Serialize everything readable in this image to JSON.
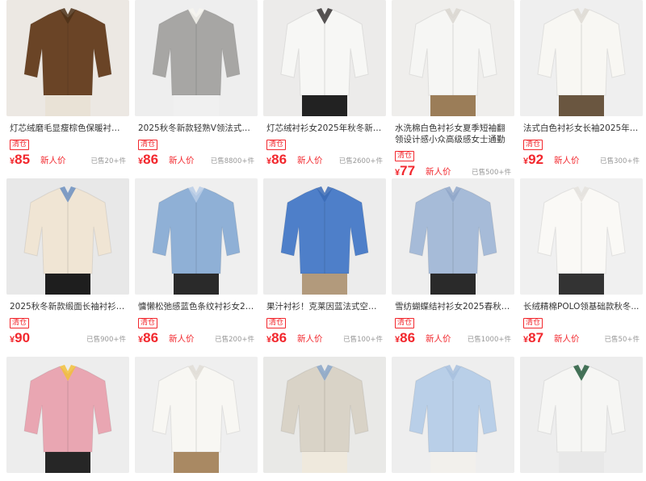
{
  "colors": {
    "accent": "#f2272d",
    "muted": "#999999",
    "text": "#333333"
  },
  "products": [
    {
      "title": "灯芯绒磨毛显瘦棕色保暖衬衫女...",
      "tag": "清仓",
      "currency": "¥",
      "price": "85",
      "label": "新人价",
      "sold": "已售20+件"
    },
    {
      "title": "2025秋冬新款轻熟V领法式长袖...",
      "tag": "清仓",
      "currency": "¥",
      "price": "86",
      "label": "新人价",
      "sold": "已售8800+件"
    },
    {
      "title": "灯芯绒衬衫女2025年秋冬新款...",
      "tag": "清仓",
      "currency": "¥",
      "price": "86",
      "label": "新人价",
      "sold": "已售2600+件"
    },
    {
      "title": "水洗棉白色衬衫女夏季短袖翻领设计感小众高级感女士通勤面试衬衣",
      "tag": "清仓",
      "currency": "¥",
      "price": "77",
      "label": "新人价",
      "sold": "已售500+件"
    },
    {
      "title": "法式白色衬衫女长袖2025年春...",
      "tag": "清仓",
      "currency": "¥",
      "price": "92",
      "label": "新人价",
      "sold": "已售300+件"
    },
    {
      "title": "2025秋冬新款缎面长袖衬衫女...",
      "tag": "清仓",
      "currency": "¥",
      "price": "90",
      "label": "",
      "sold": "已售900+件"
    },
    {
      "title": "慵懒松弛感蓝色条纹衬衫女202...",
      "tag": "清仓",
      "currency": "¥",
      "price": "86",
      "label": "新人价",
      "sold": "已售200+件"
    },
    {
      "title": "果汁衬衫！克莱因蓝法式空气感...",
      "tag": "清仓",
      "currency": "¥",
      "price": "86",
      "label": "新人价",
      "sold": "已售100+件"
    },
    {
      "title": "雪纺蝴蝶结衬衫女2025春秋新...",
      "tag": "清仓",
      "currency": "¥",
      "price": "86",
      "label": "新人价",
      "sold": "已售1000+件"
    },
    {
      "title": "长绒精棉POLO领基础款秋冬...",
      "tag": "清仓",
      "currency": "¥",
      "price": "87",
      "label": "新人价",
      "sold": "已售50+件"
    }
  ],
  "images": [
    "brown-corduroy-shirt-photo",
    "grey-white-v-neck-shirts-photo",
    "white-shirt-black-turtleneck-photo",
    "white-short-sleeve-shirt-photo",
    "white-french-shirt-photo",
    "satin-shirts-multicolor-photo",
    "blue-striped-shirt-photo",
    "klein-blue-shirt-photo",
    "blue-bow-chiffon-shirt-photo",
    "white-polo-collar-shirt-photo",
    "multicolor-folded-shirts-photo",
    "white-wrap-shirt-photo",
    "hanging-shirts-photo",
    "light-blue-shirt-photo",
    "white-green-shirts-photo"
  ]
}
